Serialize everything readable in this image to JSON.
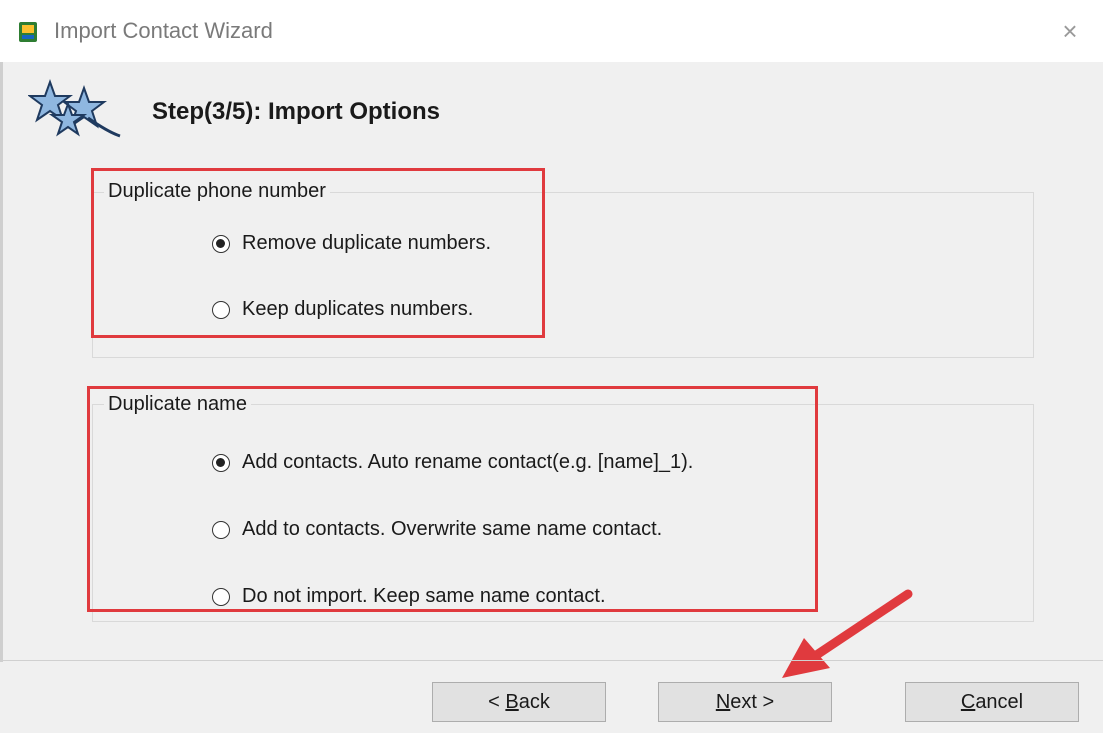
{
  "window": {
    "title": "Import Contact Wizard",
    "close_glyph": "×",
    "icon": "app-icon"
  },
  "header": {
    "step_title": "Step(3/5): Import Options",
    "icon": "wizard-stars-icon"
  },
  "phone_group": {
    "legend": "Duplicate phone number",
    "options": [
      {
        "label": "Remove duplicate numbers.",
        "checked": true
      },
      {
        "label": "Keep duplicates numbers.",
        "checked": false
      }
    ]
  },
  "name_group": {
    "legend": "Duplicate name",
    "options": [
      {
        "label": "Add contacts. Auto rename contact(e.g. [name]_1).",
        "checked": true
      },
      {
        "label": "Add to contacts. Overwrite same name contact.",
        "checked": false
      },
      {
        "label": "Do not import. Keep same name contact.",
        "checked": false
      }
    ]
  },
  "buttons": {
    "back": {
      "prefix": "< ",
      "mnemonic": "B",
      "rest": "ack"
    },
    "next": {
      "prefix": "",
      "mnemonic": "N",
      "rest": "ext >"
    },
    "cancel": {
      "prefix": "",
      "mnemonic": "C",
      "rest": "ancel"
    }
  },
  "colors": {
    "highlight": "#e03a3e",
    "dialog_bg": "#f0f0f0",
    "button_bg": "#e1e1e1"
  }
}
